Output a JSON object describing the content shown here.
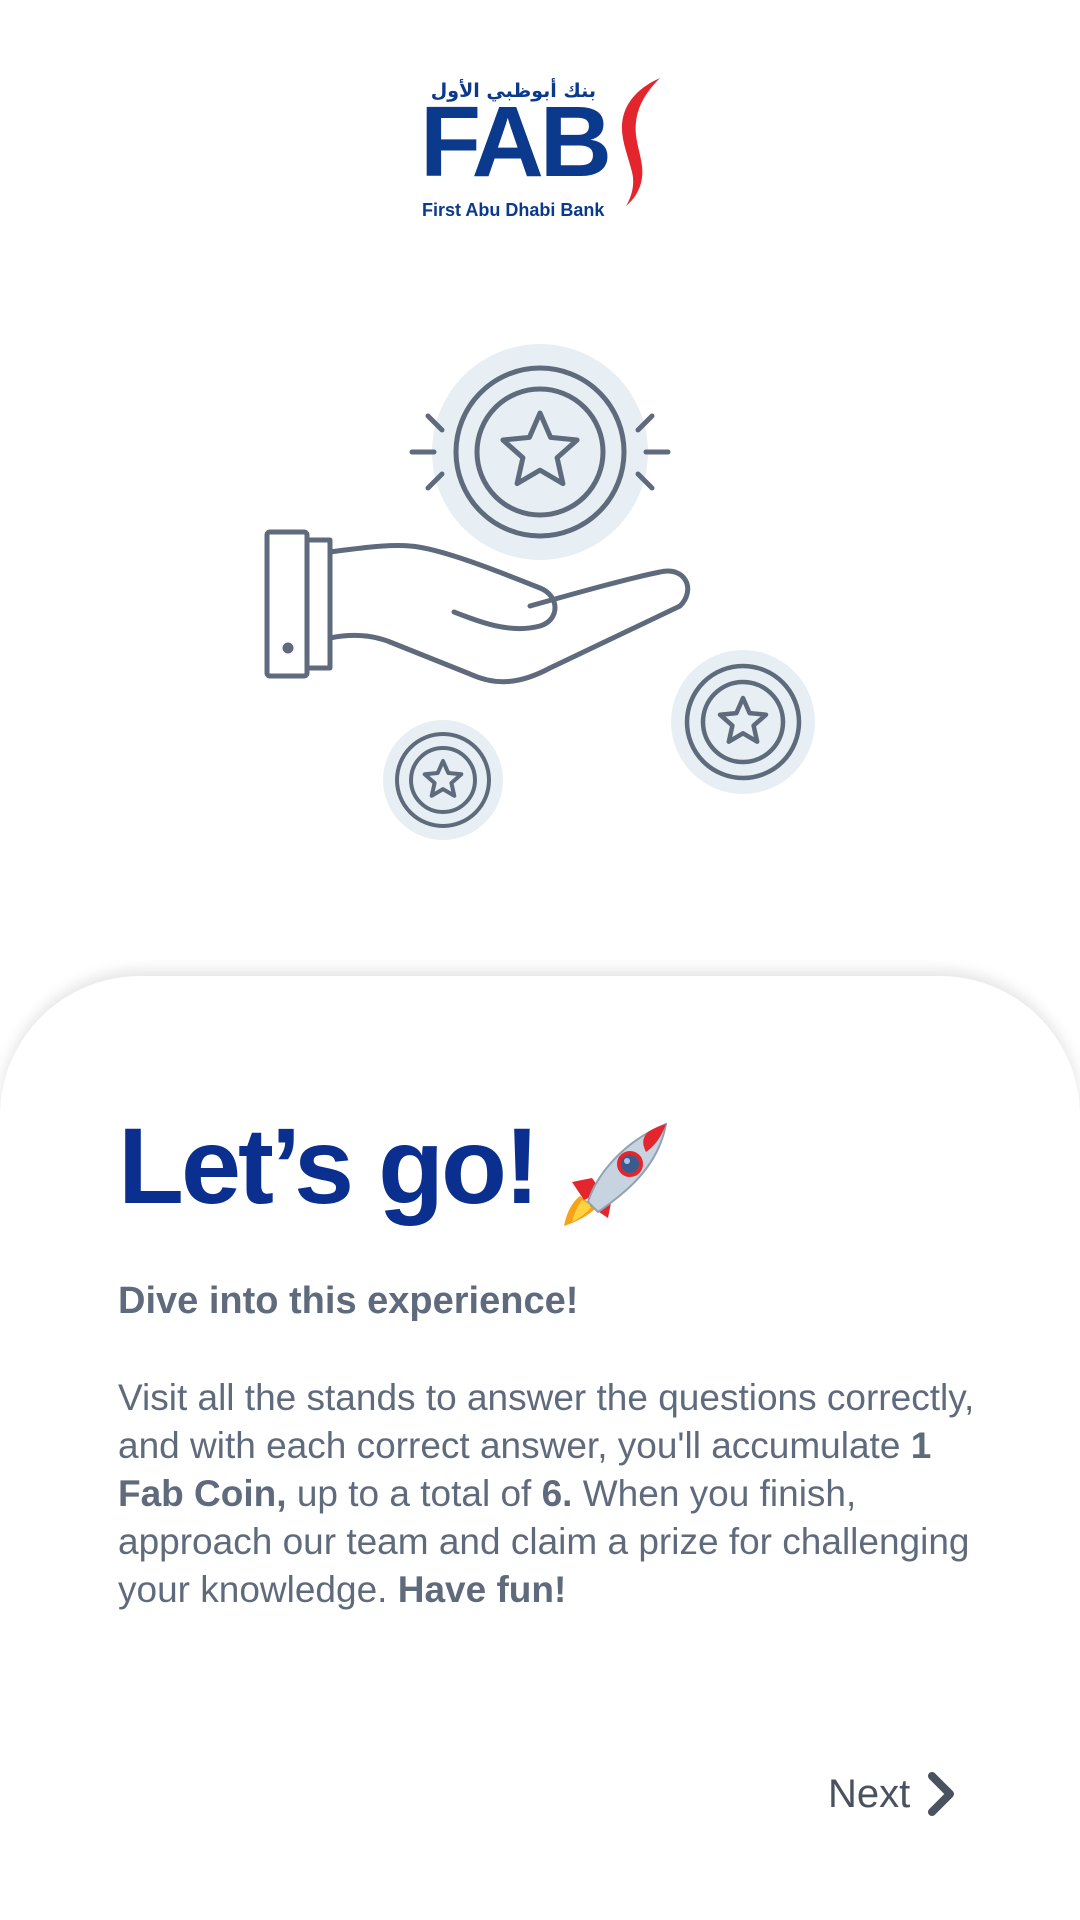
{
  "brand": {
    "arabic_name": "بنك أبوظبي الأول",
    "short_name": "FAB",
    "full_name": "First Abu Dhabi Bank",
    "primary_color": "#0b3a8c",
    "accent_color": "#e3262d"
  },
  "illustration": {
    "icon": "hand-holding-coins-icon"
  },
  "card": {
    "headline": "Let’s go!",
    "headline_emoji": "rocket-icon",
    "subtitle": "Dive into this experience!",
    "body": {
      "part1": "Visit all the stands to answer the questions correctly, and with each correct answer, you'll accumulate ",
      "coin_amount": "1 Fab Coin,",
      "part2": " up to a total of ",
      "total": "6.",
      "part3": " When you finish, approach our team and claim a prize for challenging your knowledge. ",
      "closing": "Have fun!"
    }
  },
  "navigation": {
    "next_label": "Next",
    "next_icon": "chevron-right-icon"
  },
  "colors": {
    "headline": "#0a2f8f",
    "body_text": "#5f6b7c",
    "icon_stroke": "#5f6b7c",
    "icon_fill": "#e7eff5"
  }
}
